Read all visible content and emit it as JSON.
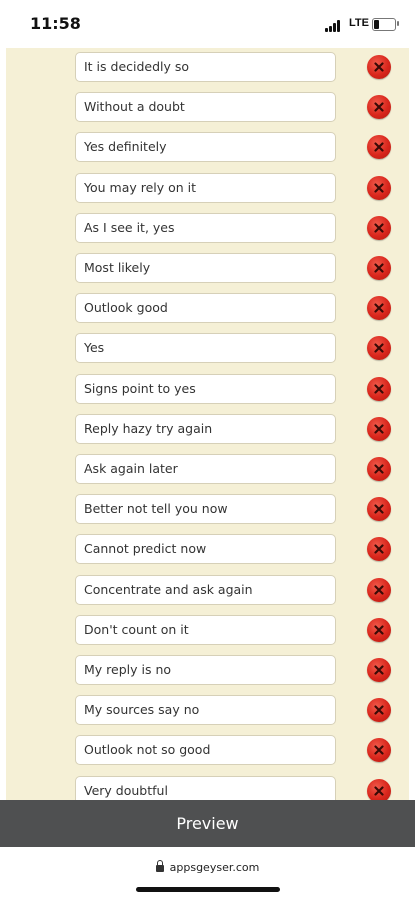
{
  "status_bar": {
    "time": "11:58",
    "network": "LTE"
  },
  "answers": [
    "It is decidedly so",
    "Without a doubt",
    "Yes definitely",
    "You may rely on it",
    "As I see it, yes",
    "Most likely",
    "Outlook good",
    "Yes",
    "Signs point to yes",
    "Reply hazy try again",
    "Ask again later",
    "Better not tell you now",
    "Cannot predict now",
    "Concentrate and ask again",
    "Don't count on it",
    "My reply is no",
    "My sources say no",
    "Outlook not so good",
    "Very doubtful"
  ],
  "preview": {
    "label": "Preview"
  },
  "browser": {
    "url": "appsgeyser.com"
  },
  "colors": {
    "list_background": "#f5f0d6",
    "delete_button": "#d9261c",
    "preview_bar": "#4f5051"
  }
}
